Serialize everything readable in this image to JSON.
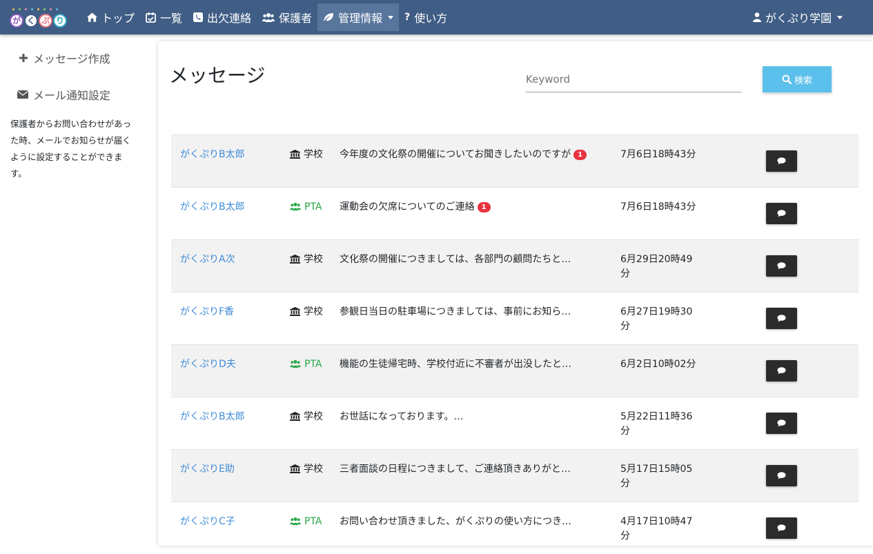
{
  "nav": {
    "brand": [
      "が",
      "く",
      "ぷ",
      "り"
    ],
    "items": [
      {
        "label": "トップ",
        "icon": "home-icon"
      },
      {
        "label": "一覧",
        "icon": "calendar-check-icon"
      },
      {
        "label": "出欠連絡",
        "icon": "phone-square-icon"
      },
      {
        "label": "保護者",
        "icon": "users-icon"
      },
      {
        "label": "管理情報",
        "icon": "leaf-icon",
        "active": true
      },
      {
        "label": "使い方",
        "icon": "question-icon"
      }
    ],
    "user": "がくぷり学園"
  },
  "sidebar": {
    "compose": "メッセージ作成",
    "mail_settings": "メール通知設定",
    "note": "保護者からお問い合わせがあった時、メールでお知らせが届くように設定することができます。"
  },
  "main": {
    "title": "メッセージ",
    "search_placeholder": "Keyword",
    "search_button": "検索"
  },
  "messages": [
    {
      "name": "がくぷりB太郎",
      "category": "学校",
      "subject": "今年度の文化祭の開催についてお聞きしたいのですが",
      "badge": "1",
      "date": "7月6日18時43分"
    },
    {
      "name": "がくぷりB太郎",
      "category": "PTA",
      "subject": "運動会の欠席についてのご連絡",
      "badge": "1",
      "date": "7月6日18時43分"
    },
    {
      "name": "がくぷりA次",
      "category": "学校",
      "subject": "文化祭の開催につきましては、各部門の顧問たちと…",
      "badge": "",
      "date": "6月29日20時49分"
    },
    {
      "name": "がくぷりF香",
      "category": "学校",
      "subject": "参観日当日の駐車場につきましては、事前にお知ら…",
      "badge": "",
      "date": "6月27日19時30分"
    },
    {
      "name": "がくぷりD夫",
      "category": "PTA",
      "subject": "機能の生徒帰宅時、学校付近に不審者が出没したと…",
      "badge": "",
      "date": "6月2日10時02分"
    },
    {
      "name": "がくぷりB太郎",
      "category": "学校",
      "subject": "お世話になっております。…",
      "badge": "",
      "date": "5月22日11時36分"
    },
    {
      "name": "がくぷりE助",
      "category": "学校",
      "subject": "三者面談の日程につきまして、ご連絡頂きありがと…",
      "badge": "",
      "date": "5月17日15時05分"
    },
    {
      "name": "がくぷりC子",
      "category": "PTA",
      "subject": "お問い合わせ頂きました、がくぷりの使い方につき…",
      "badge": "",
      "date": "4月17日10時47分"
    }
  ]
}
